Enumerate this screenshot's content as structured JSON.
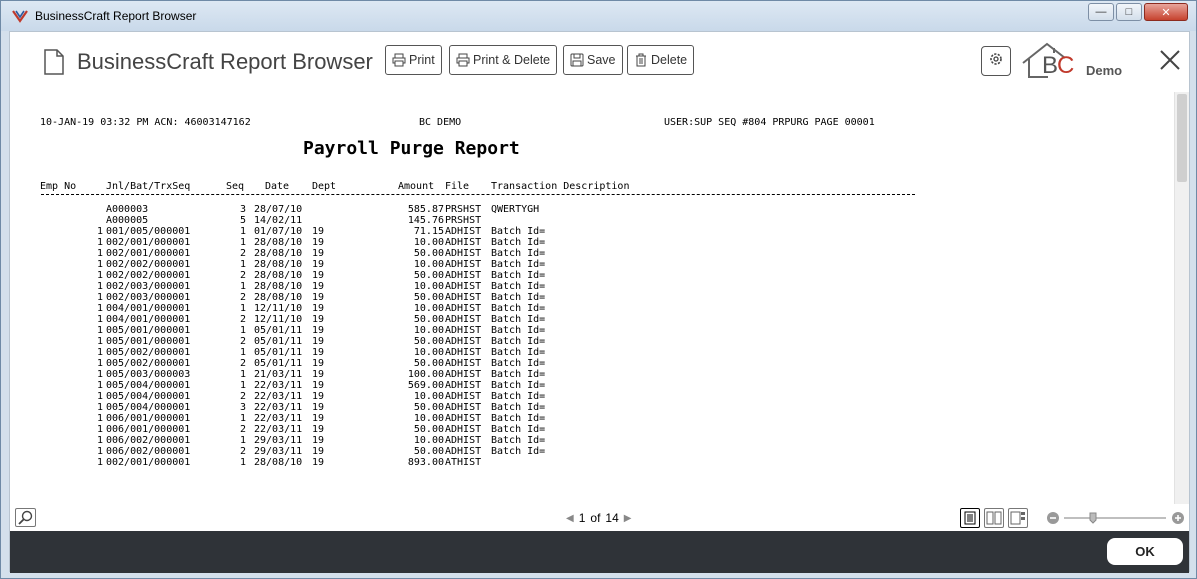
{
  "window": {
    "title": "BusinessCraft Report Browser"
  },
  "toolbar": {
    "title": "BusinessCraft Report Browser",
    "print": "Print",
    "print_delete": "Print & Delete",
    "save": "Save",
    "delete": "Delete",
    "brand_b": "B",
    "brand_c": "C",
    "demo": "Demo"
  },
  "report": {
    "header_left": "10-JAN-19 03:32 PM ACN: 46003147162",
    "header_center": "BC DEMO",
    "header_right": "USER:SUP SEQ #804 PRPURG PAGE 00001",
    "title": "Payroll Purge Report",
    "columns": [
      "Emp No",
      "Jnl/Bat/TrxSeq",
      "Seq",
      "Date",
      "Dept",
      "Amount",
      "File",
      "Transaction Description"
    ],
    "rows": [
      {
        "emp": "",
        "jnl": "A000003",
        "seq": "3",
        "date": "28/07/10",
        "dept": "",
        "amount": "585.87",
        "file": "PRSHST",
        "desc": "QWERTYGH"
      },
      {
        "emp": "",
        "jnl": "A000005",
        "seq": "5",
        "date": "14/02/11",
        "dept": "",
        "amount": "145.76",
        "file": "PRSHST",
        "desc": ""
      },
      {
        "emp": "1",
        "jnl": "001/005/000001",
        "seq": "1",
        "date": "01/07/10",
        "dept": "19",
        "amount": "71.15",
        "file": "ADHIST",
        "desc": "Batch Id="
      },
      {
        "emp": "1",
        "jnl": "002/001/000001",
        "seq": "1",
        "date": "28/08/10",
        "dept": "19",
        "amount": "10.00",
        "file": "ADHIST",
        "desc": "Batch Id="
      },
      {
        "emp": "1",
        "jnl": "002/001/000001",
        "seq": "2",
        "date": "28/08/10",
        "dept": "19",
        "amount": "50.00",
        "file": "ADHIST",
        "desc": "Batch Id="
      },
      {
        "emp": "1",
        "jnl": "002/002/000001",
        "seq": "1",
        "date": "28/08/10",
        "dept": "19",
        "amount": "10.00",
        "file": "ADHIST",
        "desc": "Batch Id="
      },
      {
        "emp": "1",
        "jnl": "002/002/000001",
        "seq": "2",
        "date": "28/08/10",
        "dept": "19",
        "amount": "50.00",
        "file": "ADHIST",
        "desc": "Batch Id="
      },
      {
        "emp": "1",
        "jnl": "002/003/000001",
        "seq": "1",
        "date": "28/08/10",
        "dept": "19",
        "amount": "10.00",
        "file": "ADHIST",
        "desc": "Batch Id="
      },
      {
        "emp": "1",
        "jnl": "002/003/000001",
        "seq": "2",
        "date": "28/08/10",
        "dept": "19",
        "amount": "50.00",
        "file": "ADHIST",
        "desc": "Batch Id="
      },
      {
        "emp": "1",
        "jnl": "004/001/000001",
        "seq": "1",
        "date": "12/11/10",
        "dept": "19",
        "amount": "10.00",
        "file": "ADHIST",
        "desc": "Batch Id="
      },
      {
        "emp": "1",
        "jnl": "004/001/000001",
        "seq": "2",
        "date": "12/11/10",
        "dept": "19",
        "amount": "50.00",
        "file": "ADHIST",
        "desc": "Batch Id="
      },
      {
        "emp": "1",
        "jnl": "005/001/000001",
        "seq": "1",
        "date": "05/01/11",
        "dept": "19",
        "amount": "10.00",
        "file": "ADHIST",
        "desc": "Batch Id="
      },
      {
        "emp": "1",
        "jnl": "005/001/000001",
        "seq": "2",
        "date": "05/01/11",
        "dept": "19",
        "amount": "50.00",
        "file": "ADHIST",
        "desc": "Batch Id="
      },
      {
        "emp": "1",
        "jnl": "005/002/000001",
        "seq": "1",
        "date": "05/01/11",
        "dept": "19",
        "amount": "10.00",
        "file": "ADHIST",
        "desc": "Batch Id="
      },
      {
        "emp": "1",
        "jnl": "005/002/000001",
        "seq": "2",
        "date": "05/01/11",
        "dept": "19",
        "amount": "50.00",
        "file": "ADHIST",
        "desc": "Batch Id="
      },
      {
        "emp": "1",
        "jnl": "005/003/000003",
        "seq": "1",
        "date": "21/03/11",
        "dept": "19",
        "amount": "100.00",
        "file": "ADHIST",
        "desc": "Batch Id="
      },
      {
        "emp": "1",
        "jnl": "005/004/000001",
        "seq": "1",
        "date": "22/03/11",
        "dept": "19",
        "amount": "569.00",
        "file": "ADHIST",
        "desc": "Batch Id="
      },
      {
        "emp": "1",
        "jnl": "005/004/000001",
        "seq": "2",
        "date": "22/03/11",
        "dept": "19",
        "amount": "10.00",
        "file": "ADHIST",
        "desc": "Batch Id="
      },
      {
        "emp": "1",
        "jnl": "005/004/000001",
        "seq": "3",
        "date": "22/03/11",
        "dept": "19",
        "amount": "50.00",
        "file": "ADHIST",
        "desc": "Batch Id="
      },
      {
        "emp": "1",
        "jnl": "006/001/000001",
        "seq": "1",
        "date": "22/03/11",
        "dept": "19",
        "amount": "10.00",
        "file": "ADHIST",
        "desc": "Batch Id="
      },
      {
        "emp": "1",
        "jnl": "006/001/000001",
        "seq": "2",
        "date": "22/03/11",
        "dept": "19",
        "amount": "50.00",
        "file": "ADHIST",
        "desc": "Batch Id="
      },
      {
        "emp": "1",
        "jnl": "006/002/000001",
        "seq": "1",
        "date": "29/03/11",
        "dept": "19",
        "amount": "10.00",
        "file": "ADHIST",
        "desc": "Batch Id="
      },
      {
        "emp": "1",
        "jnl": "006/002/000001",
        "seq": "2",
        "date": "29/03/11",
        "dept": "19",
        "amount": "50.00",
        "file": "ADHIST",
        "desc": "Batch Id="
      },
      {
        "emp": "1",
        "jnl": "002/001/000001",
        "seq": "1",
        "date": "28/08/10",
        "dept": "19",
        "amount": "893.00",
        "file": "ATHIST",
        "desc": ""
      }
    ]
  },
  "pager": {
    "current": "1",
    "of_label": "of",
    "total": "14"
  },
  "footer": {
    "ok": "OK"
  },
  "colors": {
    "brand_red": "#c0392b",
    "footer_bg": "#2f3338"
  }
}
